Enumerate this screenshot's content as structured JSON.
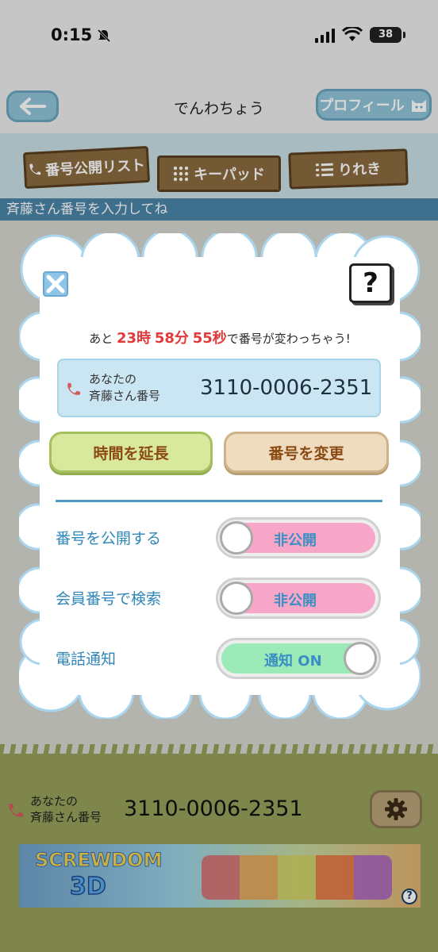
{
  "status_bar": {
    "time": "0:15",
    "battery": "38"
  },
  "header": {
    "title": "でんわちょう",
    "profile_label": "プロフィール"
  },
  "tabs": [
    {
      "label": "番号公開リスト"
    },
    {
      "label": "キーパッド"
    },
    {
      "label": "りれき"
    }
  ],
  "hint": "斉藤さん番号を入力してね",
  "modal": {
    "timer": {
      "prefix": "あと",
      "hours": "23",
      "hours_unit": "時",
      "minutes": "58",
      "minutes_unit": "分",
      "seconds": "55",
      "seconds_unit": "秒",
      "suffix": "で番号が変わっちゃう!"
    },
    "number_card": {
      "label_line1": "あなたの",
      "label_line2": "斉藤さん番号",
      "number": "3110-0006-2351"
    },
    "extend_button": "時間を延長",
    "change_button": "番号を変更",
    "help_glyph": "?",
    "settings": [
      {
        "label": "番号を公開する",
        "state": "非公開",
        "on": false
      },
      {
        "label": "会員番号で検索",
        "state": "非公開",
        "on": false
      },
      {
        "label": "電話通知",
        "state": "通知 ON",
        "on": true
      }
    ]
  },
  "bottom_bar": {
    "label_line1": "あなたの",
    "label_line2": "斉藤さん番号",
    "number": "3110-0006-2351"
  },
  "ad": {
    "title": "SCREWDOM",
    "subtitle": "3D",
    "help_glyph": "?"
  },
  "colors": {
    "accent_blue": "#2f86b8",
    "timer_red": "#e23a3a",
    "toggle_off": "#f7a6c8",
    "toggle_on": "#9ceab8"
  }
}
